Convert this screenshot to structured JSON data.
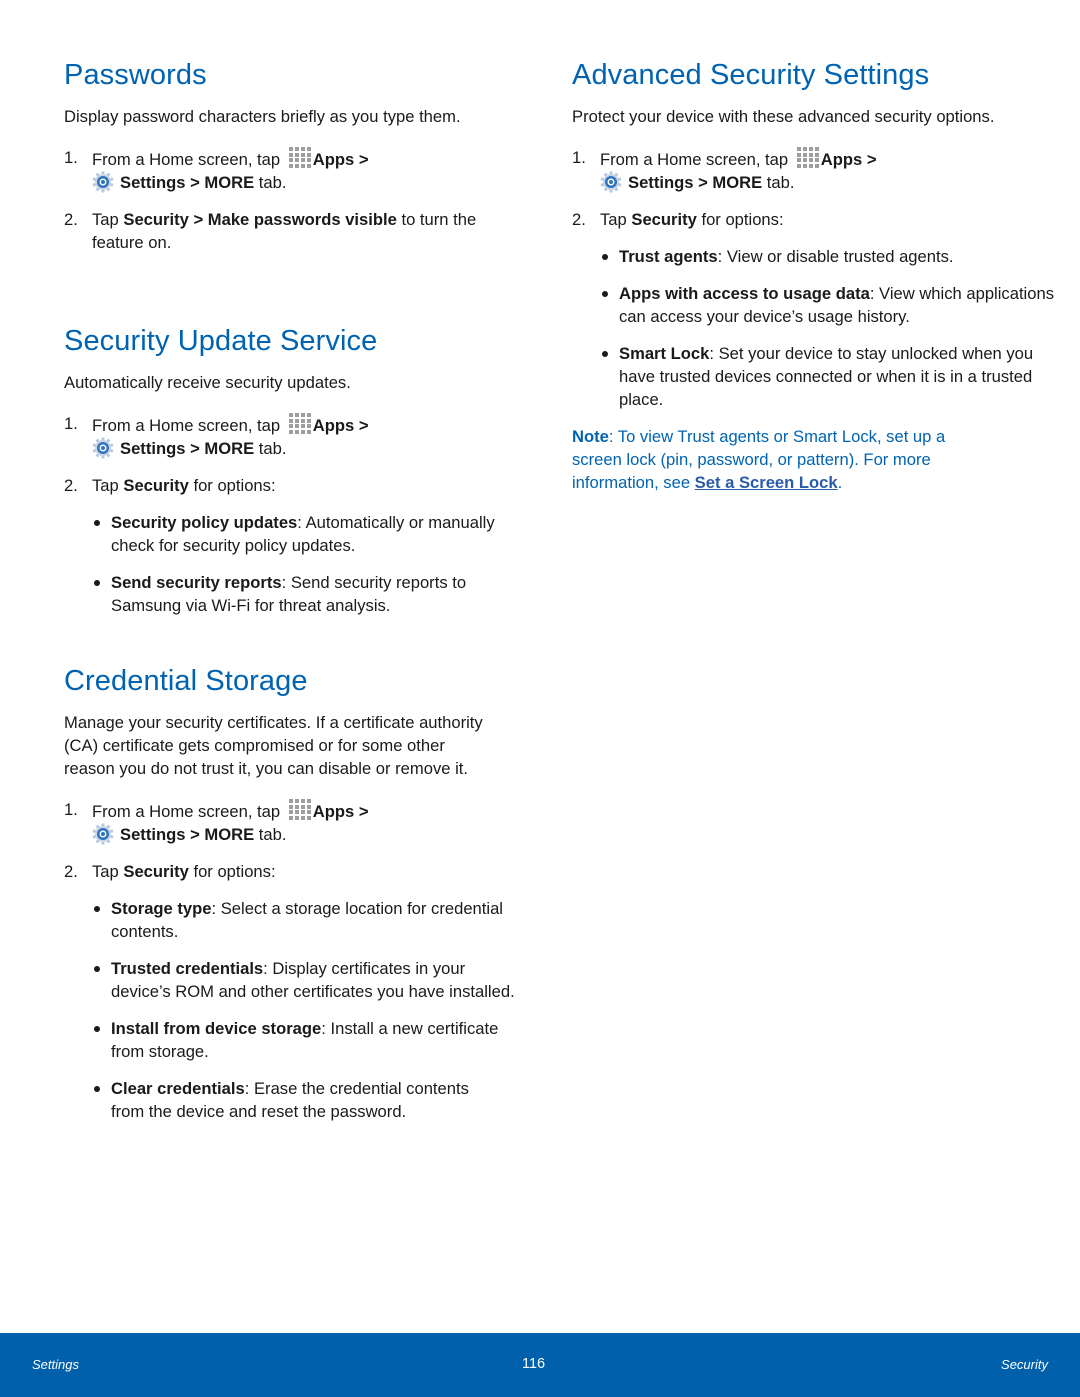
{
  "left_column": {
    "passwords": {
      "title": "Passwords",
      "intro": "Display password characters briefly as you type them.",
      "steps": [
        {
          "num": "1.",
          "pre": "From a Home screen, tap",
          "apps": "Apps",
          "sep1": " >",
          "settings": "Settings",
          "sep2": " > ",
          "more": "MORE",
          "post": " tab."
        },
        {
          "num": "2.",
          "pre": "Tap ",
          "b1": "Security",
          "mid": " > ",
          "b2": "Make passwords visible",
          "post": " to turn the feature on."
        }
      ]
    },
    "security_update": {
      "title": "Security Update Service",
      "intro": "Automatically receive security updates.",
      "steps": [
        {
          "num": "1.",
          "pre": "From a Home screen, tap",
          "apps": "Apps",
          "sep1": " >",
          "settings": "Settings",
          "sep2": " > ",
          "more": "MORE",
          "post": " tab."
        },
        {
          "num": "2.",
          "pre": "Tap ",
          "b1": "Security",
          "post": " for options:"
        }
      ],
      "bullets": [
        {
          "term": "Security policy updates",
          "desc": ": Automatically or manually check for security policy updates."
        },
        {
          "term": "Send security reports",
          "desc": ": Send security reports to Samsung via Wi-Fi for threat analysis."
        }
      ]
    },
    "credential_storage": {
      "title": "Credential Storage",
      "intro": "Manage your security certificates. If a certificate authority (CA) certificate gets compromised or for some other reason you do not trust it, you can disable or remove it.",
      "steps": [
        {
          "num": "1.",
          "pre": "From a Home screen, tap",
          "apps": "Apps",
          "sep1": " >",
          "settings": "Settings",
          "sep2": " > ",
          "more": "MORE",
          "post": " tab."
        },
        {
          "num": "2.",
          "pre": "Tap ",
          "b1": "Security",
          "post": " for options:"
        }
      ],
      "bullets": [
        {
          "term": "Storage type",
          "desc": ": Select a storage location for credential contents."
        },
        {
          "term": "Trusted credentials",
          "desc": ": Display certificates in your device’s ROM and other certificates you have installed."
        },
        {
          "term": "Install from device storage",
          "desc": ": Install a new certificate from storage."
        },
        {
          "term": "Clear credentials",
          "desc": ": Erase the credential contents from the device and reset the password."
        }
      ]
    }
  },
  "right_column": {
    "advanced": {
      "title": "Advanced Security Settings",
      "intro": "Protect your device with these advanced security options.",
      "steps": [
        {
          "num": "1.",
          "pre": "From a Home screen, tap",
          "apps": "Apps",
          "sep1": " >",
          "settings": "Settings",
          "sep2": " > ",
          "more": "MORE",
          "post": " tab."
        },
        {
          "num": "2.",
          "pre": "Tap ",
          "b1": "Security",
          "post": " for options:"
        }
      ],
      "bullets": [
        {
          "term": "Trust agents",
          "desc": ": View or disable trusted agents."
        },
        {
          "term": "Apps with access to usage data",
          "desc": ": View which applications can access your device’s usage history."
        },
        {
          "term": "Smart Lock",
          "desc": ": Set your device to stay unlocked when you have trusted devices connected or when it is in a trusted place."
        }
      ],
      "note": {
        "label": "Note",
        "text": ": To view Trust agents or Smart Lock, set up a screen lock (pin, password, or pattern). For more information, see ",
        "link": "Set a Screen Lock",
        "end": "."
      }
    }
  },
  "footer": {
    "left": "Settings",
    "page_number": "116",
    "right": "Security"
  },
  "colors": {
    "heading": "#0063b1",
    "footer_bg": "#0060ab",
    "text": "#1a1a1a"
  },
  "icons": {
    "apps": "apps-grid-icon",
    "settings": "settings-gear-icon"
  }
}
